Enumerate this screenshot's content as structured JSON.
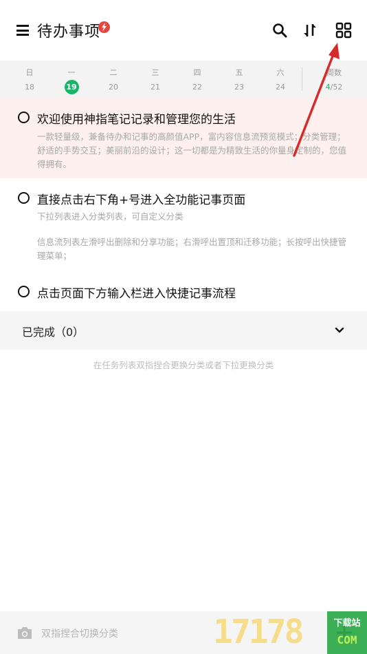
{
  "header": {
    "title": "待办事项",
    "icons": [
      "menu-icon",
      "lightning-badge-icon",
      "search-icon",
      "sort-icon",
      "grid-icon"
    ]
  },
  "week": {
    "days": [
      {
        "name": "日",
        "num": "18",
        "today": false
      },
      {
        "name": "一",
        "num": "19",
        "today": true
      },
      {
        "name": "二",
        "num": "20",
        "today": false
      },
      {
        "name": "三",
        "num": "21",
        "today": false
      },
      {
        "name": "四",
        "num": "22",
        "today": false
      },
      {
        "name": "五",
        "num": "23",
        "today": false
      },
      {
        "name": "六",
        "num": "24",
        "today": false
      }
    ],
    "weeknum_label": "周数",
    "weeknum_current": "4",
    "weeknum_total": "/52"
  },
  "tasks": [
    {
      "title": "欢迎使用神指笔记记录和管理您的生活",
      "desc": "一款轻量级，兼备待办和记事的高颜值APP，富内容信息流预览模式；分类管理；舒适的手势交互；美丽前沿的设计；这一切都是为精致生活的你量身定制的，您值得拥有。"
    },
    {
      "title": "直接点击右下角+号进入全功能记事页面",
      "desc": "下拉列表进入分类列表，可自定义分类",
      "desc2": "信息流列表左滑呼出删除和分享功能；右滑呼出置顶和迁移功能；长按呼出快捷管理菜单；"
    },
    {
      "title": "点击页面下方输入栏进入快捷记事流程"
    }
  ],
  "completed": {
    "label": "已完成（0）"
  },
  "hint": "在任务列表双指捏合更换分类或者下拉更换分类",
  "bottom": {
    "placeholder": "双指捏合切换分类"
  },
  "watermark": {
    "digits": "17178",
    "top": "下载站",
    "bottom": "COM"
  },
  "colors": {
    "accent": "#1ab36a",
    "badge": "#e8453c",
    "highlight_bg": "#fdf0ef",
    "annotation_arrow": "#d62b2b"
  }
}
